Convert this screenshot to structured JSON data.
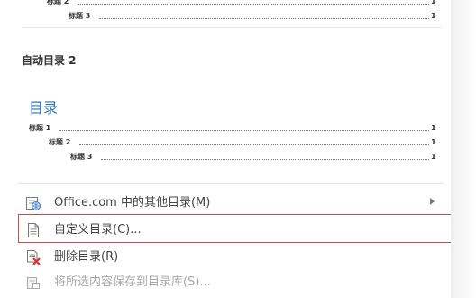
{
  "toc_top": {
    "rows": [
      {
        "label": "标题 2",
        "page": "1"
      },
      {
        "label": "标题 3",
        "page": "1"
      }
    ]
  },
  "auto_toc_2": {
    "title": "自动目录 2",
    "heading": "目录",
    "rows": [
      {
        "label": "标题 1",
        "page": "1"
      },
      {
        "label": "标题 2",
        "page": "1"
      },
      {
        "label": "标题 3",
        "page": "1"
      }
    ]
  },
  "menu": {
    "more_toc": "Office.com 中的其他目录(M)",
    "custom_toc": "自定义目录(C)...",
    "remove_toc": "删除目录(R)",
    "save_selection": "将所选内容保存到目录库(S)..."
  }
}
